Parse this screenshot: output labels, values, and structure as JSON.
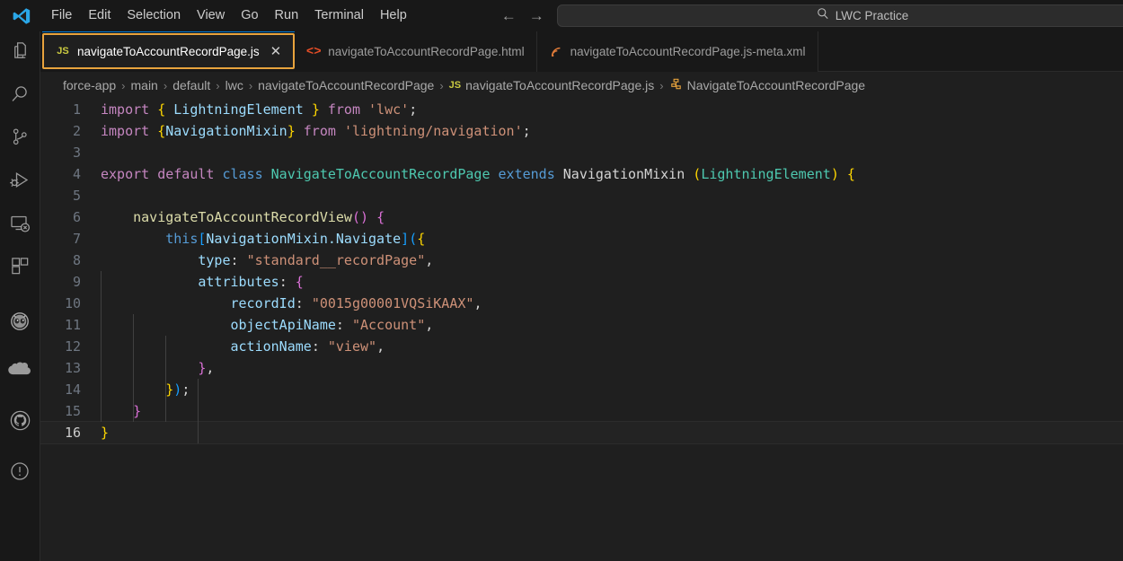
{
  "titlebar": {
    "logo_icon": "vscode-logo-icon",
    "menu": [
      {
        "label": "File"
      },
      {
        "label": "Edit"
      },
      {
        "label": "Selection"
      },
      {
        "label": "View"
      },
      {
        "label": "Go"
      },
      {
        "label": "Run"
      },
      {
        "label": "Terminal"
      },
      {
        "label": "Help"
      }
    ],
    "nav": {
      "back_icon": "arrow-left-icon",
      "forward_icon": "arrow-right-icon"
    },
    "search": {
      "icon": "search-icon",
      "value": "LWC Practice",
      "placeholder": "Search"
    }
  },
  "activitybar": {
    "items": [
      {
        "name": "explorer",
        "icon": "files-icon"
      },
      {
        "name": "search",
        "icon": "search-icon"
      },
      {
        "name": "source-control",
        "icon": "source-control-icon"
      },
      {
        "name": "run-and-debug",
        "icon": "run-debug-icon"
      },
      {
        "name": "remote-explorer",
        "icon": "remote-explorer-icon"
      },
      {
        "name": "extensions",
        "icon": "extensions-icon"
      },
      {
        "name": "einstein",
        "icon": "einstein-bot-icon"
      },
      {
        "name": "salesforce",
        "icon": "salesforce-cloud-icon"
      },
      {
        "name": "github",
        "icon": "github-icon"
      },
      {
        "name": "problems",
        "icon": "warning-circle-icon"
      }
    ]
  },
  "tabs": [
    {
      "label": "navigateToAccountRecordPage.js",
      "icon": "js-file-icon",
      "active": true,
      "close_label": "✕"
    },
    {
      "label": "navigateToAccountRecordPage.html",
      "icon": "html-file-icon",
      "active": false
    },
    {
      "label": "navigateToAccountRecordPage.js-meta.xml",
      "icon": "xml-file-icon",
      "active": false
    }
  ],
  "breadcrumb": {
    "separator": "›",
    "items": [
      {
        "label": "force-app",
        "icon": null
      },
      {
        "label": "main",
        "icon": null
      },
      {
        "label": "default",
        "icon": null
      },
      {
        "label": "lwc",
        "icon": null
      },
      {
        "label": "navigateToAccountRecordPage",
        "icon": null
      },
      {
        "label": "navigateToAccountRecordPage.js",
        "icon": "js-file-icon"
      },
      {
        "label": "NavigateToAccountRecordPage",
        "icon": "symbol-class-icon"
      }
    ]
  },
  "editor": {
    "active_line": 16,
    "lines": [
      {
        "n": "1",
        "text": "import { LightningElement } from 'lwc';"
      },
      {
        "n": "2",
        "text": "import {NavigationMixin} from 'lightning/navigation';"
      },
      {
        "n": "3",
        "text": ""
      },
      {
        "n": "4",
        "text": "export default class NavigateToAccountRecordPage extends NavigationMixin (LightningElement) {"
      },
      {
        "n": "5",
        "text": ""
      },
      {
        "n": "6",
        "text": "    navigateToAccountRecordView() {"
      },
      {
        "n": "7",
        "text": "        this[NavigationMixin.Navigate]({"
      },
      {
        "n": "8",
        "text": "            type: \"standard__recordPage\","
      },
      {
        "n": "9",
        "text": "            attributes: {"
      },
      {
        "n": "10",
        "text": "                recordId: \"0015g00001VQSiKAAX\","
      },
      {
        "n": "11",
        "text": "                objectApiName: \"Account\","
      },
      {
        "n": "12",
        "text": "                actionName: \"view\","
      },
      {
        "n": "13",
        "text": "            },"
      },
      {
        "n": "14",
        "text": "        });"
      },
      {
        "n": "15",
        "text": "    }"
      },
      {
        "n": "16",
        "text": "}"
      }
    ]
  },
  "colors": {
    "editor_bg": "#1f1f1f",
    "chrome_bg": "#181818",
    "accent_focus": "#e8a33d",
    "tab_active_top": "#0078d4",
    "keyword": "#c586c0",
    "control": "#569cd6",
    "class": "#4ec9b0",
    "variable": "#9cdcfe",
    "string": "#ce9178",
    "function": "#dcdcaa"
  }
}
